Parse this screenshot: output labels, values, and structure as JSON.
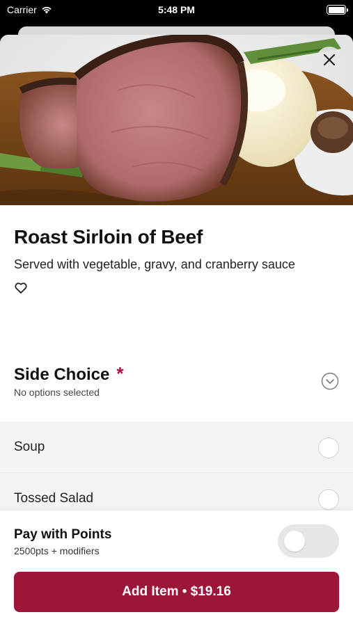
{
  "status_bar": {
    "carrier": "Carrier",
    "time": "5:48 PM"
  },
  "item": {
    "title": "Roast Sirloin of Beef",
    "description": "Served with vegetable, gravy, and cranberry sauce",
    "favorite_icon": "heart-outline-icon",
    "hero_image": "roast-beef-photo"
  },
  "side_choice": {
    "title": "Side Choice",
    "required_marker": "*",
    "subtitle": "No options selected",
    "options": [
      {
        "label": "Soup",
        "selected": false
      },
      {
        "label": "Tossed Salad",
        "selected": false
      }
    ]
  },
  "pay_with_points": {
    "title": "Pay with Points",
    "subtitle": "2500pts + modifiers",
    "enabled": false
  },
  "add_button": {
    "label": "Add Item • $19.16"
  },
  "colors": {
    "brand": "#9b1638",
    "required": "#b0123e"
  }
}
